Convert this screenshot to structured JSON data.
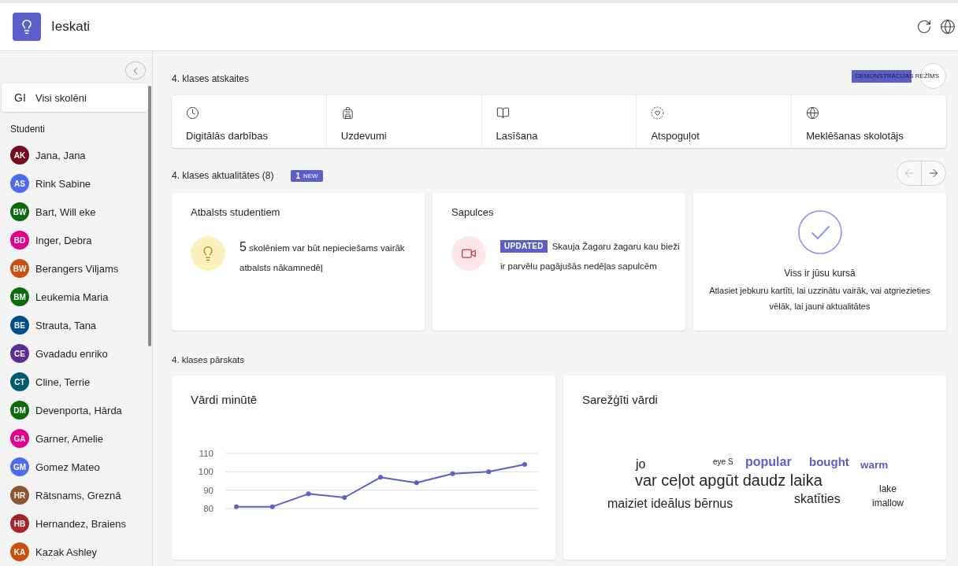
{
  "app": {
    "title": "Ieskati"
  },
  "sidebar": {
    "all_item": {
      "initials": "GI",
      "label": "Visi skolēni",
      "selected": true
    },
    "section_label": "Studenti",
    "students": [
      {
        "initials": "AK",
        "name": "Jana, Jana",
        "color": "#750b1c",
        "selected": false
      },
      {
        "initials": "AS",
        "name": "Rink Sabine",
        "color": "#4f6bed",
        "selected": false
      },
      {
        "initials": "BW",
        "name": "Bart, Will eke",
        "color": "#0b6a0b",
        "selected": false
      },
      {
        "initials": "BD",
        "name": "Inger, Debra",
        "color": "#e3008c",
        "selected": false
      },
      {
        "initials": "BW",
        "name": "Berangers Viljams",
        "color": "#ca5010",
        "selected": false
      },
      {
        "initials": "BM",
        "name": "Leukemia Maria",
        "color": "#0b6a0b",
        "selected": false
      },
      {
        "initials": "BE",
        "name": "Strauta, Tana",
        "color": "#004e8c",
        "selected": false
      },
      {
        "initials": "CE",
        "name": "Gvadadu enriko",
        "color": "#5c2e91",
        "selected": false
      },
      {
        "initials": "CT",
        "name": "Cline, Terrie",
        "color": "#005b70",
        "selected": false
      },
      {
        "initials": "DM",
        "name": "Devenporta, Hārda",
        "color": "#0b6a0b",
        "selected": false
      },
      {
        "initials": "GA",
        "name": "Garner, Amelie",
        "color": "#e3008c",
        "selected": false
      },
      {
        "initials": "GM",
        "name": "Gomez Mateo",
        "color": "#4f6bed",
        "selected": false
      },
      {
        "initials": "HR",
        "name": "Rātsnams, Greznā",
        "color": "#8e562e",
        "selected": false
      },
      {
        "initials": "HB",
        "name": "Hernandez, Braiens",
        "color": "#a4262c",
        "selected": false
      },
      {
        "initials": "KA",
        "name": "Kazak Ashley",
        "color": "#ca5010",
        "selected": false
      }
    ]
  },
  "reports": {
    "title": "4. klases atskaites",
    "demo_badge": "DEMONSTRĀCIJAS REŽĪMS",
    "tiles": [
      {
        "label": "Digitālās darbības"
      },
      {
        "label": "Uzdevumi"
      },
      {
        "label": "Lasīšana"
      },
      {
        "label": "Atspoguļot"
      },
      {
        "label": "Meklēšanas skolotājs"
      }
    ]
  },
  "updates": {
    "title": "4. klases aktualitātes (8)",
    "new_badge": {
      "count": "1",
      "label": "NEW"
    },
    "pager": {
      "previous": {
        "disabled": true
      },
      "next": {
        "disabled": false
      }
    },
    "cards": [
      {
        "kind": "support",
        "title": "Atbalsts studentiem",
        "count": "5",
        "text": "skolēniem var būt nepieciešams vairāk atbalsts nākamnedēļ"
      },
      {
        "kind": "meeting",
        "title": "Sapulces",
        "badge": "UPDATED",
        "text": "Skauja Žagaru žagaru kau bieži ir parvēlu pagājušās nedēļas sapulcēm"
      },
      {
        "kind": "done",
        "title": "Viss ir jūsu kursā",
        "text": "Atlasiet jebkuru kartīti, lai uzzinātu vairāk, vai atgriezieties vēlāk, lai jauni aktualitātes"
      }
    ]
  },
  "overview": {
    "title": "4. klases pārskats",
    "wpm": {
      "chart_data": {
        "type": "line",
        "title": "Vārdi minūtē",
        "series": [
          {
            "color": "#5b5fc7",
            "marker": "o",
            "values": [
              81,
              81,
              88,
              86,
              97,
              94,
              99,
              100,
              104
            ]
          }
        ],
        "ylim": [
          80,
          110
        ],
        "yticks": [
          80,
          90,
          100,
          110
        ]
      }
    },
    "difficult_words": {
      "title": "Sarežģīti vārdi",
      "words": [
        {
          "text": "jo",
          "color": "#242424"
        },
        {
          "text": "eye S",
          "color": "#242424"
        },
        {
          "text": "popular",
          "color": "#5b5fc7"
        },
        {
          "text": "bought",
          "color": "#5b5fc7"
        },
        {
          "text": "warm",
          "color": "#5b5fc7"
        },
        {
          "text": "var ceļot apgūt daudz laika",
          "color": "#242424"
        },
        {
          "text": "lake",
          "color": "#242424"
        },
        {
          "text": "maiziet ideālus bērnus",
          "color": "#242424"
        },
        {
          "text": "skatīties",
          "color": "#242424"
        },
        {
          "text": "imallow",
          "color": "#242424"
        }
      ]
    }
  }
}
